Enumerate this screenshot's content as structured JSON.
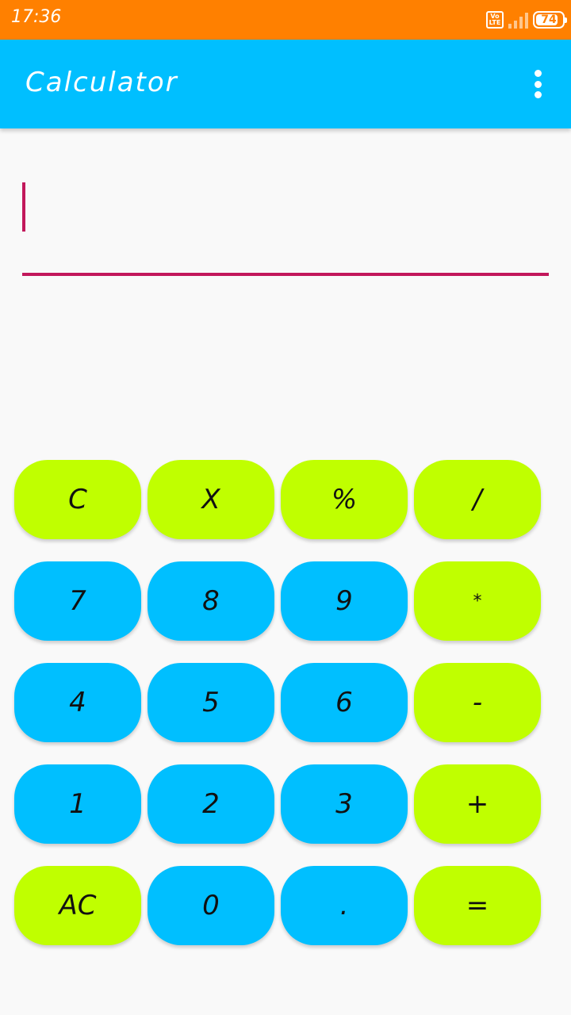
{
  "status_bar": {
    "time": "17:36",
    "volte_top": "Vo",
    "volte_bottom": "LTE",
    "battery": "74",
    "color": "#ff8000"
  },
  "app_bar": {
    "title": "Calculator",
    "menu_icon": "more-vert-icon",
    "color": "#00bfff"
  },
  "display": {
    "value": "",
    "accent_color": "#c2185b"
  },
  "keypad": {
    "colors": {
      "operator": "#c0ff00",
      "digit": "#00bfff"
    },
    "keys": [
      {
        "label": "C"
      },
      {
        "label": "X"
      },
      {
        "label": "%"
      },
      {
        "label": "/"
      },
      {
        "label": "7"
      },
      {
        "label": "8"
      },
      {
        "label": "9"
      },
      {
        "label": "*"
      },
      {
        "label": "4"
      },
      {
        "label": "5"
      },
      {
        "label": "6"
      },
      {
        "label": "-"
      },
      {
        "label": "1"
      },
      {
        "label": "2"
      },
      {
        "label": "3"
      },
      {
        "label": "+"
      },
      {
        "label": "AC"
      },
      {
        "label": "0"
      },
      {
        "label": "."
      },
      {
        "label": "="
      }
    ]
  }
}
